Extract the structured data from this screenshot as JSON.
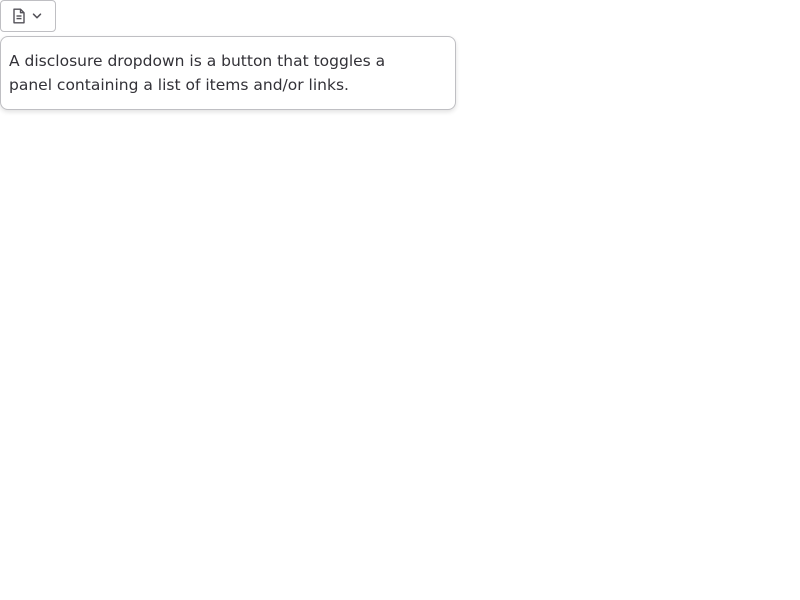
{
  "toggle": {
    "icon": "document-icon",
    "chevron": "chevron-down-icon"
  },
  "panel": {
    "text": "A disclosure dropdown is a button that toggles a panel containing a list of items and/or links."
  }
}
